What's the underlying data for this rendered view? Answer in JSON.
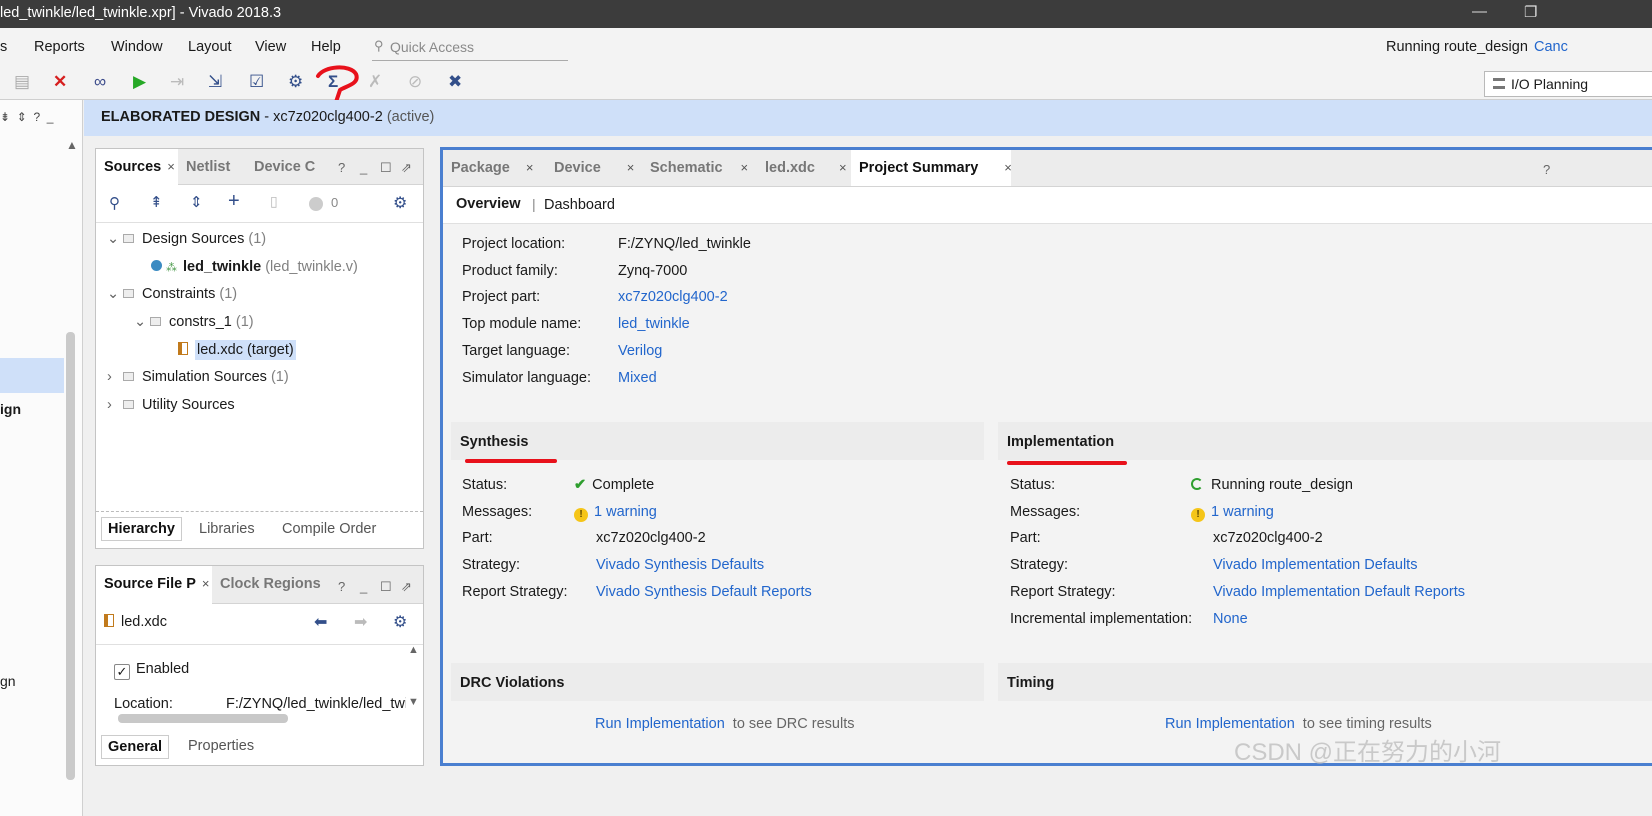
{
  "window": {
    "title": "led_twinkle/led_twinkle.xpr] - Vivado 2018.3",
    "status": "Running route_design",
    "cancel": "Canc"
  },
  "menu": {
    "items": [
      "s",
      "Reports",
      "Window",
      "Layout",
      "View",
      "Help"
    ],
    "quick_access": "Quick Access"
  },
  "toolbar": {
    "layout_select": "I/O Planning"
  },
  "banner": {
    "title": "ELABORATED DESIGN",
    "part": "- xc7z020clg400-2",
    "state": "(active)"
  },
  "left_strip": {
    "labels": [
      "ign",
      "gn"
    ]
  },
  "sources": {
    "tabs": [
      "Sources",
      "Netlist",
      "Device C"
    ],
    "status_count": "0",
    "tree": [
      {
        "label": "Design Sources",
        "count": "(1)"
      },
      {
        "label": "led_twinkle",
        "sub": "(led_twinkle.v)"
      },
      {
        "label": "Constraints",
        "count": "(1)"
      },
      {
        "label": "constrs_1",
        "count": "(1)"
      },
      {
        "label": "led.xdc (target)"
      },
      {
        "label": "Simulation Sources",
        "count": "(1)"
      },
      {
        "label": "Utility Sources"
      }
    ],
    "bottom_tabs": [
      "Hierarchy",
      "Libraries",
      "Compile Order"
    ]
  },
  "source_file": {
    "tabs": [
      "Source File P",
      "Clock Regions"
    ],
    "file": "led.xdc",
    "enabled_label": "Enabled",
    "location_label": "Location:",
    "location_value": "F:/ZYNQ/led_twinkle/led_twin",
    "bottom_tabs": [
      "General",
      "Properties"
    ]
  },
  "main": {
    "tabs": [
      "Package",
      "Device",
      "Schematic",
      "led.xdc",
      "Project Summary"
    ],
    "subtabs": [
      "Overview",
      "Dashboard"
    ],
    "project": [
      {
        "label": "Project location:",
        "value": "F:/ZYNQ/led_twinkle",
        "link": false
      },
      {
        "label": "Product family:",
        "value": "Zynq-7000",
        "link": false
      },
      {
        "label": "Project part:",
        "value": "xc7z020clg400-2",
        "link": true
      },
      {
        "label": "Top module name:",
        "value": "led_twinkle",
        "link": true
      },
      {
        "label": "Target language:",
        "value": "Verilog",
        "link": true
      },
      {
        "label": "Simulator language:",
        "value": "Mixed",
        "link": true
      }
    ],
    "synthesis": {
      "title": "Synthesis",
      "rows": [
        {
          "label": "Status:",
          "value": "Complete",
          "link": false
        },
        {
          "label": "Messages:",
          "value": "1 warning",
          "link": true
        },
        {
          "label": "Part:",
          "value": "xc7z020clg400-2",
          "link": false
        },
        {
          "label": "Strategy:",
          "value": "Vivado Synthesis Defaults",
          "link": true
        },
        {
          "label": "Report Strategy:",
          "value": "Vivado Synthesis Default Reports",
          "link": true
        }
      ]
    },
    "implementation": {
      "title": "Implementation",
      "rows": [
        {
          "label": "Status:",
          "value": "Running route_design",
          "link": false
        },
        {
          "label": "Messages:",
          "value": "1 warning",
          "link": true
        },
        {
          "label": "Part:",
          "value": "xc7z020clg400-2",
          "link": false
        },
        {
          "label": "Strategy:",
          "value": "Vivado Implementation Defaults",
          "link": true
        },
        {
          "label": "Report Strategy:",
          "value": "Vivado Implementation Default Reports",
          "link": true
        },
        {
          "label": "Incremental implementation:",
          "value": "None",
          "link": true
        }
      ]
    },
    "drc": {
      "title": "DRC Violations",
      "link": "Run Implementation",
      "text": "to see DRC results"
    },
    "timing": {
      "title": "Timing",
      "link": "Run Implementation",
      "text": "to see timing results"
    }
  },
  "watermark": "CSDN @正在努力的小河"
}
